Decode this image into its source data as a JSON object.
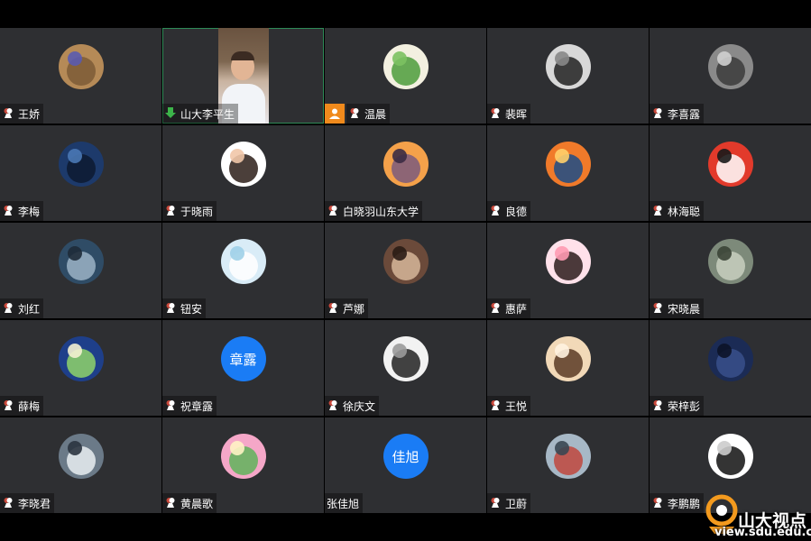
{
  "participants": [
    {
      "name": "王娇",
      "avatar": "monkey-plush-avatar",
      "colors": [
        "#b58a57",
        "#7d5a36",
        "#5a5bb0"
      ]
    },
    {
      "name": "山大李平生",
      "avatar": "host-video",
      "speaking": true
    },
    {
      "name": "温晨",
      "avatar": "tree-avatar",
      "colors": [
        "#f3f0e0",
        "#4c9c3b",
        "#7cc162"
      ],
      "camera_off_flag": true
    },
    {
      "name": "裴晖",
      "avatar": "street-photo-avatar",
      "colors": [
        "#d8d8d8",
        "#222222",
        "#888888"
      ]
    },
    {
      "name": "李喜露",
      "avatar": "car-avatar",
      "colors": [
        "#8a8a8a",
        "#3b3b3b",
        "#cfcfcf"
      ]
    },
    {
      "name": "李梅",
      "avatar": "night-city-avatar",
      "colors": [
        "#1d3a6b",
        "#0d1a30",
        "#4a78b5"
      ]
    },
    {
      "name": "于晓雨",
      "avatar": "cartoon-girl-avatar",
      "colors": [
        "#ffffff",
        "#2b1d18",
        "#f1c7a9"
      ]
    },
    {
      "name": "白晓羽山东大学",
      "avatar": "sunset-avatar",
      "colors": [
        "#f4a14a",
        "#7a5a7c",
        "#3b2b44"
      ]
    },
    {
      "name": "良德",
      "avatar": "sunset-sea-avatar",
      "colors": [
        "#f07a2a",
        "#1c4c87",
        "#ffcf6a"
      ]
    },
    {
      "name": "林海聪",
      "avatar": "red-bird-avatar",
      "colors": [
        "#e23a2b",
        "#ffffff",
        "#1a1a1a"
      ]
    },
    {
      "name": "刘红",
      "avatar": "bridge-avatar",
      "colors": [
        "#2f4c66",
        "#9bb3c6",
        "#1e2b38"
      ]
    },
    {
      "name": "钮安",
      "avatar": "flower-avatar",
      "colors": [
        "#d9ecf7",
        "#ffffff",
        "#9ed0e8"
      ]
    },
    {
      "name": "芦娜",
      "avatar": "portrait-avatar",
      "colors": [
        "#6b4a3a",
        "#d6b69a",
        "#2a1c15"
      ]
    },
    {
      "name": "惠萨",
      "avatar": "anime-girl-avatar",
      "colors": [
        "#ffe1ea",
        "#2b1b1b",
        "#ff9bb3"
      ]
    },
    {
      "name": "宋晓晨",
      "avatar": "building-avatar",
      "colors": [
        "#7d8a7a",
        "#c8cfc0",
        "#3b4436"
      ]
    },
    {
      "name": "薛梅",
      "avatar": "fish-map-avatar",
      "colors": [
        "#1e3f8a",
        "#8fd46a",
        "#f4f1d2"
      ]
    },
    {
      "name": "祝章露",
      "avatar": "text-avatar",
      "avatar_text": "章露",
      "colors": [
        "#1a7cf5"
      ]
    },
    {
      "name": "徐庆文",
      "avatar": "horse-drawing-avatar",
      "colors": [
        "#f2f2f2",
        "#222222",
        "#9a9a9a"
      ]
    },
    {
      "name": "王悦",
      "avatar": "child-photo-avatar",
      "colors": [
        "#f2d9b8",
        "#5a3a24",
        "#fff2e0"
      ]
    },
    {
      "name": "荣梓彭",
      "avatar": "dark-figure-avatar",
      "colors": [
        "#1b2b55",
        "#38508c",
        "#0c1328"
      ]
    },
    {
      "name": "李晓君",
      "avatar": "mountain-avatar",
      "colors": [
        "#6b7a88",
        "#e9eef2",
        "#2b3440"
      ]
    },
    {
      "name": "黄晨歌",
      "avatar": "lotus-avatar",
      "colors": [
        "#f5a7c8",
        "#5fb35a",
        "#fff3c4"
      ]
    },
    {
      "name": "张佳旭",
      "avatar": "text-avatar",
      "avatar_text": "佳旭",
      "colors": [
        "#1a7cf5"
      ],
      "no_mic": true
    },
    {
      "name": "卫蔚",
      "avatar": "people-photo-avatar",
      "colors": [
        "#a7b8c6",
        "#c0473d",
        "#3a4752"
      ]
    },
    {
      "name": "李鹏鹏",
      "avatar": "yinyang-avatar",
      "colors": [
        "#ffffff",
        "#111111",
        "#cccccc"
      ]
    }
  ],
  "watermark": {
    "logo_text": "山大视点",
    "url": "view.sdu.edu.cn",
    "accent": "#f39a1e"
  }
}
